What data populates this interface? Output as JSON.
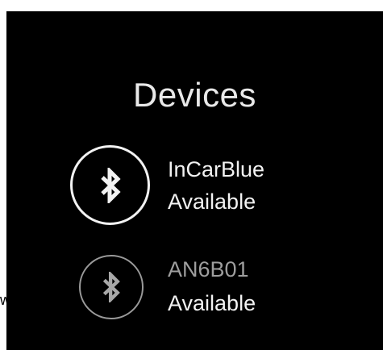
{
  "title": "Devices",
  "devices": [
    {
      "name": "InCarBlue",
      "status": "Available",
      "icon": "bluetooth-icon",
      "selected": true,
      "name_color": "#f2f2f2"
    },
    {
      "name": "AN6B01",
      "status": "Available",
      "icon": "bluetooth-icon",
      "selected": false,
      "name_color": "#9e9e9e"
    }
  ],
  "side_fragment": "w",
  "colors": {
    "background": "#000000",
    "text": "#f2f2f2",
    "muted": "#9e9e9e"
  }
}
